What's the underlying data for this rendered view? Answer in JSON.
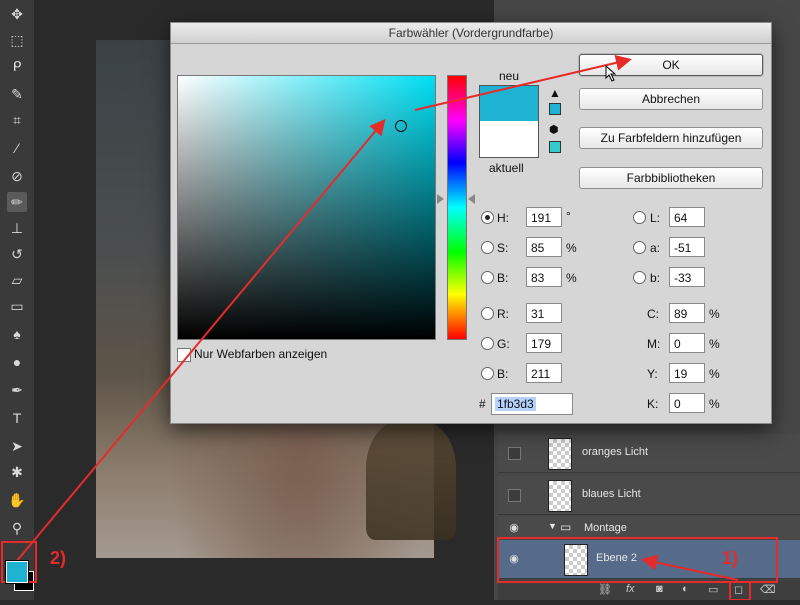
{
  "dialog": {
    "title": "Farbwähler (Vordergrundfarbe)",
    "preview_new_label": "neu",
    "preview_current_label": "aktuell",
    "buttons": {
      "ok": "OK",
      "cancel": "Abbrechen",
      "add_swatches": "Zu Farbfeldern hinzufügen",
      "libraries": "Farbbibliotheken"
    },
    "web_colors_label": "Nur Webfarben anzeigen",
    "hsb": {
      "h_label": "H:",
      "h_value": "191",
      "h_unit": "°",
      "s_label": "S:",
      "s_value": "85",
      "s_unit": "%",
      "b_label": "B:",
      "b_value": "83",
      "b_unit": "%"
    },
    "rgb": {
      "r_label": "R:",
      "r_value": "31",
      "g_label": "G:",
      "g_value": "179",
      "b_label": "B:",
      "b_value": "211"
    },
    "lab": {
      "l_label": "L:",
      "l_value": "64",
      "a_label": "a:",
      "a_value": "-51",
      "b_label": "b:",
      "b_value": "-33"
    },
    "cmyk": {
      "c_label": "C:",
      "c_value": "89",
      "c_unit": "%",
      "m_label": "M:",
      "m_value": "0",
      "m_unit": "%",
      "y_label": "Y:",
      "y_value": "19",
      "y_unit": "%",
      "k_label": "K:",
      "k_value": "0",
      "k_unit": "%"
    },
    "hex_label": "#",
    "hex_value": "1fb3d3"
  },
  "colors": {
    "selected": "#1fb3d3",
    "previous": "#ffffff",
    "annotation": "#e62b2b"
  },
  "layers": {
    "items": [
      {
        "name": "oranges Licht"
      },
      {
        "name": "blaues Licht"
      }
    ],
    "group_name": "Montage",
    "selected_layer": "Ebene 2"
  },
  "annotations": {
    "step1": "1)",
    "step2": "2)"
  },
  "icons": {
    "warning": "warning-triangle-icon",
    "websafe": "cube-icon",
    "eye": "eye-icon",
    "folder": "folder-icon"
  }
}
